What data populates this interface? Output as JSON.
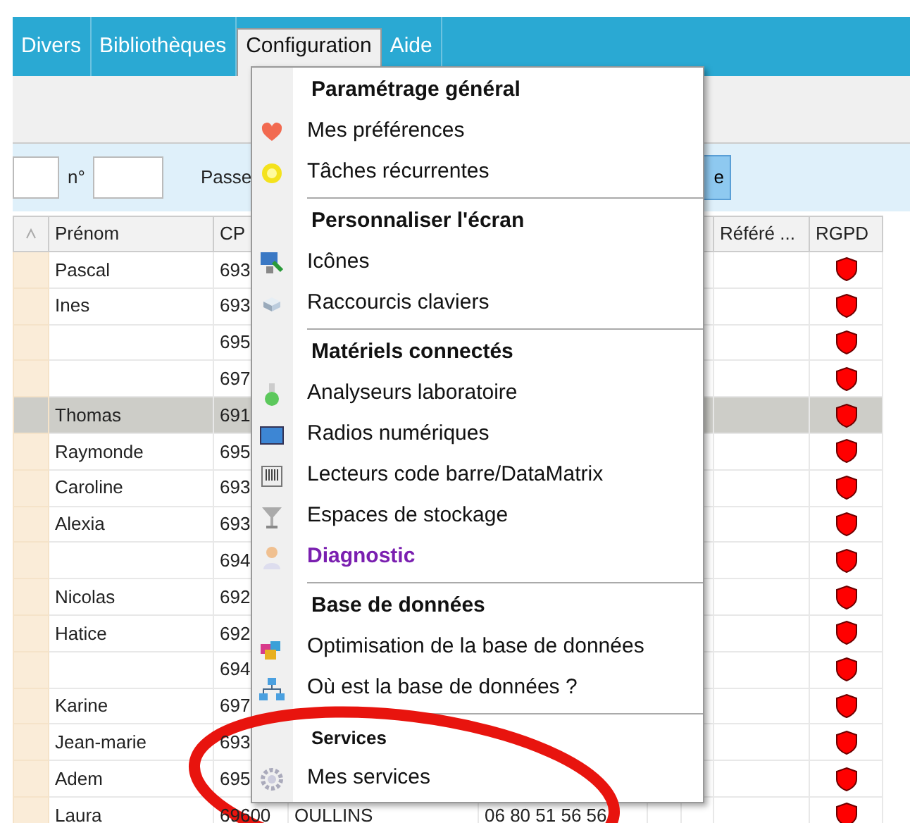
{
  "menubar": [
    {
      "label": "Divers",
      "selected": false
    },
    {
      "label": "Bibliothèques",
      "selected": false
    },
    {
      "label": "Configuration",
      "selected": true
    },
    {
      "label": "Aide",
      "selected": false
    }
  ],
  "filter_bar": {
    "number_label": "n°",
    "pass_label": "Passe",
    "button_label": "e"
  },
  "table": {
    "columns": [
      "Prénom",
      "CP",
      "Référé ...",
      "RGPD"
    ],
    "rows": [
      {
        "first_name": "Pascal",
        "cp": "693",
        "selected": false
      },
      {
        "first_name": "Ines",
        "cp": "693",
        "selected": false
      },
      {
        "first_name": "",
        "cp": "695",
        "selected": false
      },
      {
        "first_name": "",
        "cp": "697",
        "selected": false
      },
      {
        "first_name": "Thomas",
        "cp": "691",
        "selected": true
      },
      {
        "first_name": "Raymonde",
        "cp": "695",
        "selected": false
      },
      {
        "first_name": "Caroline",
        "cp": "693",
        "selected": false
      },
      {
        "first_name": "Alexia",
        "cp": "693",
        "selected": false
      },
      {
        "first_name": "",
        "cp": "694",
        "selected": false
      },
      {
        "first_name": "Nicolas",
        "cp": "692",
        "selected": false
      },
      {
        "first_name": "Hatice",
        "cp": "692",
        "selected": false
      },
      {
        "first_name": "",
        "cp": "694",
        "selected": false
      },
      {
        "first_name": "Karine",
        "cp": "697",
        "selected": false
      },
      {
        "first_name": "Jean-marie",
        "cp": "693",
        "selected": false
      },
      {
        "first_name": "Adem",
        "cp": "695",
        "selected": false
      },
      {
        "first_name": "Laura",
        "cp": "69600",
        "column_4": "OULLINS",
        "column_5": "06 80 51 56 56",
        "selected": false
      }
    ]
  },
  "dropdown_menu": [
    {
      "kind": "header",
      "label": "Paramétrage général"
    },
    {
      "kind": "item",
      "label": "Mes préférences",
      "emphasized": false
    },
    {
      "kind": "item",
      "label": "Tâches récurrentes",
      "emphasized": false
    },
    {
      "kind": "separator"
    },
    {
      "kind": "header",
      "label": "Personnaliser l'écran"
    },
    {
      "kind": "item",
      "label": "Icônes",
      "emphasized": false
    },
    {
      "kind": "item",
      "label": "Raccourcis claviers",
      "emphasized": false
    },
    {
      "kind": "separator"
    },
    {
      "kind": "header",
      "label": "Matériels connectés"
    },
    {
      "kind": "item",
      "label": "Analyseurs laboratoire",
      "emphasized": false
    },
    {
      "kind": "item",
      "label": "Radios numériques",
      "emphasized": false
    },
    {
      "kind": "item",
      "label": "Lecteurs code barre/DataMatrix",
      "emphasized": false
    },
    {
      "kind": "item",
      "label": "Espaces de stockage",
      "emphasized": false
    },
    {
      "kind": "item",
      "label": "Diagnostic",
      "emphasized": true
    },
    {
      "kind": "separator"
    },
    {
      "kind": "header",
      "label": "Base de données"
    },
    {
      "kind": "item",
      "label": "Optimisation de la base de données",
      "emphasized": false
    },
    {
      "kind": "item",
      "label": "Où est la base de données ?",
      "emphasized": false
    },
    {
      "kind": "separator"
    },
    {
      "kind": "small-header",
      "label": "Services"
    },
    {
      "kind": "item",
      "label": "Mes services",
      "emphasized": false
    }
  ]
}
